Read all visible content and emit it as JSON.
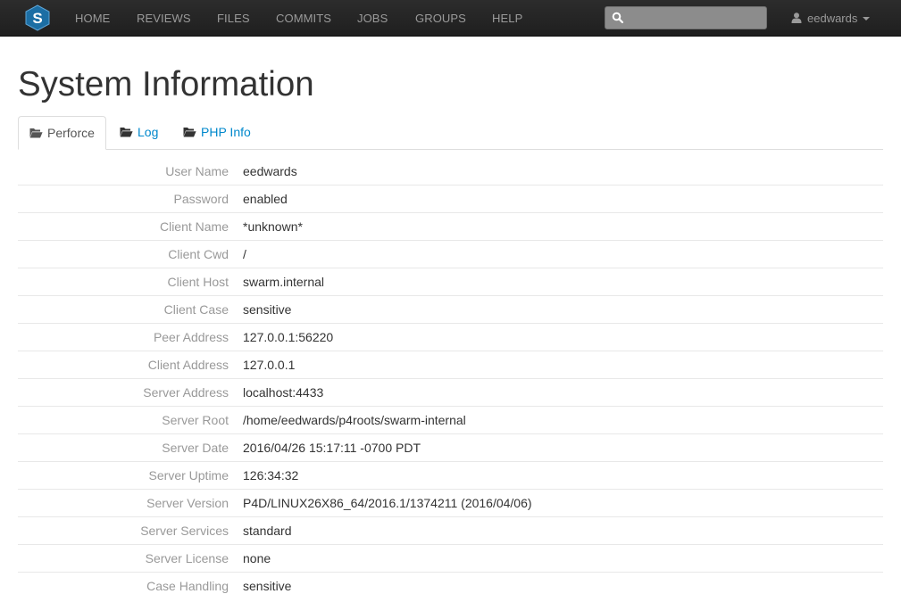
{
  "navbar": {
    "logo_letter": "S",
    "items": [
      {
        "label": "HOME"
      },
      {
        "label": "REVIEWS"
      },
      {
        "label": "FILES"
      },
      {
        "label": "COMMITS"
      },
      {
        "label": "JOBS"
      },
      {
        "label": "GROUPS"
      },
      {
        "label": "HELP"
      }
    ],
    "search": {
      "value": "",
      "placeholder": ""
    },
    "user": {
      "name": "eedwards"
    }
  },
  "page": {
    "title": "System Information"
  },
  "tabs": [
    {
      "label": "Perforce",
      "active": true
    },
    {
      "label": "Log",
      "active": false
    },
    {
      "label": "PHP Info",
      "active": false
    }
  ],
  "info": [
    {
      "label": "User Name",
      "value": "eedwards"
    },
    {
      "label": "Password",
      "value": "enabled"
    },
    {
      "label": "Client Name",
      "value": "*unknown*"
    },
    {
      "label": "Client Cwd",
      "value": "/"
    },
    {
      "label": "Client Host",
      "value": "swarm.internal"
    },
    {
      "label": "Client Case",
      "value": "sensitive"
    },
    {
      "label": "Peer Address",
      "value": "127.0.0.1:56220"
    },
    {
      "label": "Client Address",
      "value": "127.0.0.1"
    },
    {
      "label": "Server Address",
      "value": "localhost:4433"
    },
    {
      "label": "Server Root",
      "value": "/home/eedwards/p4roots/swarm-internal"
    },
    {
      "label": "Server Date",
      "value": "2016/04/26 15:17:11 -0700 PDT"
    },
    {
      "label": "Server Uptime",
      "value": "126:34:32"
    },
    {
      "label": "Server Version",
      "value": "P4D/LINUX26X86_64/2016.1/1374211 (2016/04/06)"
    },
    {
      "label": "Server Services",
      "value": "standard"
    },
    {
      "label": "Server License",
      "value": "none"
    },
    {
      "label": "Case Handling",
      "value": "sensitive"
    }
  ],
  "colors": {
    "navbar_bg": "#222222",
    "nav_text": "#9a9a9a",
    "link": "#0088cc",
    "logo_blue": "#1c6ea4"
  }
}
